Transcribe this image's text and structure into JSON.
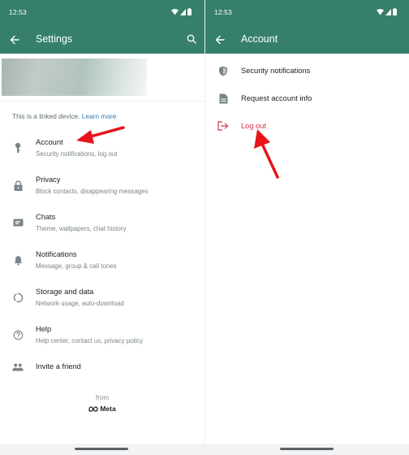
{
  "left_panel": {
    "status_bar": {
      "time": "12:53",
      "icons": [
        "wifi-icon",
        "signal-icon",
        "battery-icon"
      ]
    },
    "app_bar": {
      "title": "Settings",
      "back_icon": "arrow-back-icon",
      "search_icon": "search-icon"
    },
    "linked_note": {
      "text": "This is a linked device.",
      "link": "Learn more"
    },
    "items": [
      {
        "icon": "key-icon",
        "title": "Account",
        "subtitle": "Security notifications, log out"
      },
      {
        "icon": "lock-icon",
        "title": "Privacy",
        "subtitle": "Block contacts, disappearing messages"
      },
      {
        "icon": "chat-icon",
        "title": "Chats",
        "subtitle": "Theme, wallpapers, chat history"
      },
      {
        "icon": "bell-icon",
        "title": "Notifications",
        "subtitle": "Message, group & call tones"
      },
      {
        "icon": "storage-icon",
        "title": "Storage and data",
        "subtitle": "Network usage, auto-download"
      },
      {
        "icon": "help-icon",
        "title": "Help",
        "subtitle": "Help center, contact us, privacy policy"
      },
      {
        "icon": "people-icon",
        "title": "Invite a friend",
        "subtitle": ""
      }
    ],
    "footer": {
      "from": "from",
      "brand": "Meta"
    }
  },
  "right_panel": {
    "status_bar": {
      "time": "12:53",
      "icons": [
        "wifi-icon",
        "signal-icon",
        "battery-icon"
      ]
    },
    "app_bar": {
      "title": "Account",
      "back_icon": "arrow-back-icon"
    },
    "items": [
      {
        "icon": "shield-icon",
        "label": "Security notifications",
        "danger": false
      },
      {
        "icon": "document-icon",
        "label": "Request account info",
        "danger": false
      },
      {
        "icon": "logout-icon",
        "label": "Log out",
        "danger": true
      }
    ]
  },
  "colors": {
    "app_bar": "#36806b",
    "danger": "#d0364b",
    "link": "#2e7bb6",
    "annotation_arrow": "#e8141b",
    "icon_gray": "#7a858a"
  }
}
